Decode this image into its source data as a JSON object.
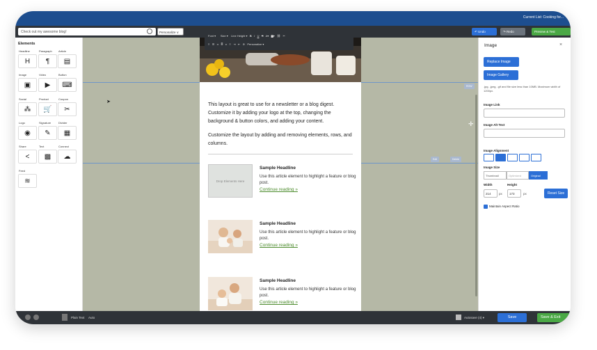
{
  "header": {
    "campaign": "Current List: Cooking for..."
  },
  "toolbar": {
    "subject_placeholder": "Check out my awesome blog!",
    "personalize": "Personalize ∨",
    "undo": "↶ Undo",
    "redo": "↷ Redo",
    "preview": "Preview & Test"
  },
  "elements": {
    "title": "Elements",
    "items": [
      {
        "label": "Headline",
        "glyph": "H"
      },
      {
        "label": "Paragraph",
        "glyph": "¶"
      },
      {
        "label": "Article",
        "glyph": "▤"
      },
      {
        "label": "Image",
        "glyph": "▣"
      },
      {
        "label": "Video",
        "glyph": "▶"
      },
      {
        "label": "Button",
        "glyph": "⌨"
      },
      {
        "label": "Social",
        "glyph": "⁂"
      },
      {
        "label": "Product",
        "glyph": "🛒"
      },
      {
        "label": "Coupon",
        "glyph": "✂"
      },
      {
        "label": "Logo",
        "glyph": "◉"
      },
      {
        "label": "Signature",
        "glyph": "✎"
      },
      {
        "label": "Divider",
        "glyph": "▦"
      },
      {
        "label": "Share",
        "glyph": "<"
      },
      {
        "label": "Text",
        "glyph": "▩"
      },
      {
        "label": "Connect",
        "glyph": "☁"
      },
      {
        "label": "Feed",
        "glyph": "≋"
      }
    ]
  },
  "format_bar": {
    "font": "Font",
    "size": "Size",
    "line_height": "Line Height",
    "bold": "B",
    "italic": "I",
    "underline": "U",
    "strike": "S",
    "personalize": "Personalize ▾"
  },
  "email": {
    "intro_1": "This layout is great to use for a newsletter or a blog digest. Customize it by adding your logo at the top, changing the background & button colors, and adding your content.",
    "intro_2": "Customize the layout by adding and removing elements, rows, and columns.",
    "row_badge": "ROW",
    "edit": "Edit",
    "delete": "Delete",
    "drop_label": "Drop Elements Here",
    "articles": [
      {
        "headline": "Sample Headline",
        "body": "Use this article element to highlight a feature or blog post.",
        "link": "Continue reading »"
      },
      {
        "headline": "Sample Headline",
        "body": "Use this article element to highlight a feature or blog post.",
        "link": "Continue reading »"
      },
      {
        "headline": "Sample Headline",
        "body": "Use this article element to highlight a feature or blog post.",
        "link": "Continue reading »"
      }
    ]
  },
  "image_panel": {
    "title": "Image",
    "close": "×",
    "replace": "Replace Image",
    "gallery": "Image Gallery",
    "note": ".jpg, .jpeg, .gif and file size less than 10MB. Maximum width of 1200px.",
    "link_label": "Image Link",
    "alt_label": "Image Alt Text",
    "alignment_label": "Image Alignment",
    "size_label": "Image Size",
    "sizes": [
      "Thumbnail",
      "Optimized",
      "Original"
    ],
    "width_label": "Width",
    "height_label": "Height",
    "width": "214",
    "height": "173",
    "px": "px",
    "reset": "Reset Size",
    "maintain": "Maintain Aspect Ratio"
  },
  "footer": {
    "plain_text": "Plain Text",
    "mode": "Auto",
    "autosave": "Autosave (4) ▾",
    "save": "Save",
    "save_exit": "Save & Exit"
  }
}
